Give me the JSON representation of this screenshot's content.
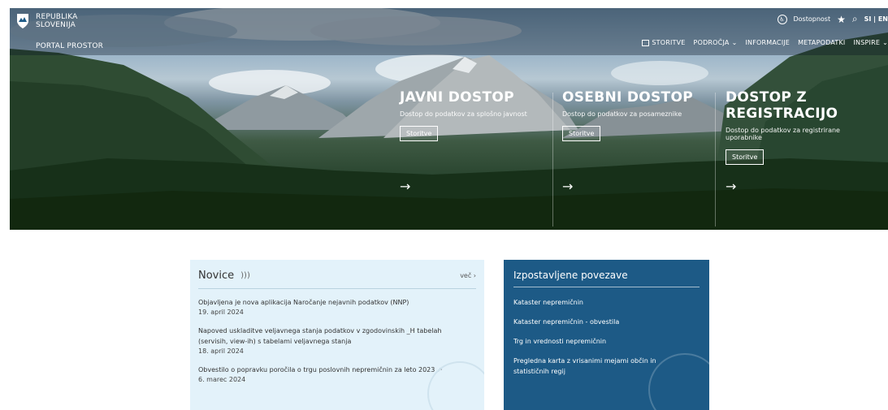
{
  "header": {
    "brand_line1": "REPUBLIKA",
    "brand_line2": "SLOVENIJA",
    "portal_name": "PORTAL PROSTOR",
    "accessibility": "Dostopnost",
    "lang": "SI | EN",
    "nav": [
      {
        "label": "STORITVE"
      },
      {
        "label": "PODROČJA"
      },
      {
        "label": "INFORMACIJE"
      },
      {
        "label": "METAPODATKI"
      },
      {
        "label": "INSPIRE"
      }
    ]
  },
  "hero": {
    "panels": [
      {
        "title": "JAVNI DOSTOP",
        "desc": "Dostop do podatkov za splošno javnost",
        "button": "Storitve"
      },
      {
        "title": "OSEBNI DOSTOP",
        "desc": "Dostop do podatkov za posameznike",
        "button": "Storitve"
      },
      {
        "title_line1": "DOSTOP Z",
        "title_line2": "REGISTRACIJO",
        "desc_line1": "Dostop do podatkov za registrirane",
        "desc_line2": "uporabnike",
        "button": "Storitve"
      }
    ]
  },
  "news": {
    "title": "Novice",
    "more": "več",
    "items": [
      {
        "title": "Objavljena je nova aplikacija Naročanje nejavnih podatkov (NNP)",
        "date": "19. april 2024"
      },
      {
        "title_line1": "Napoved uskladitve veljavnega stanja podatkov v zgodovinskih _H tabelah",
        "title_line2": "(servisih, view-ih) s tabelami veljavnega stanja",
        "date": "18. april 2024"
      },
      {
        "title": "Obvestilo o popravku poročila o trgu poslovnih nepremičnin za leto 2023",
        "date": "6. marec 2024"
      }
    ]
  },
  "links": {
    "title": "Izpostavljene povezave",
    "items": [
      {
        "label": "Kataster nepremičnin"
      },
      {
        "label": "Kataster nepremičnin - obvestila"
      },
      {
        "label": "Trg in vrednosti nepremičnin"
      },
      {
        "label_line1": "Pregledna karta z vrisanimi mejami občin in",
        "label_line2": "statističnih regij"
      }
    ]
  }
}
